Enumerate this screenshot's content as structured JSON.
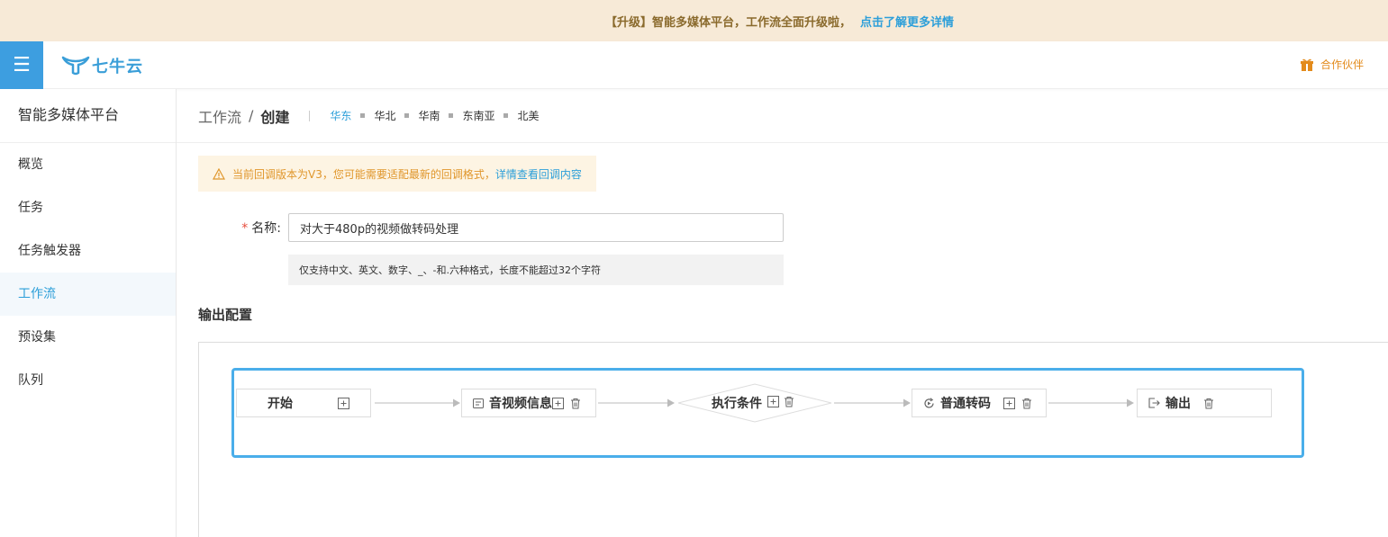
{
  "banner": {
    "text": "【升级】智能多媒体平台，工作流全面升级啦，",
    "link": "点击了解更多详情"
  },
  "header": {
    "logo_text": "七牛云",
    "partner": "合作伙伴"
  },
  "sidebar": {
    "title": "智能多媒体平台",
    "items": [
      {
        "label": "概览"
      },
      {
        "label": "任务"
      },
      {
        "label": "任务触发器"
      },
      {
        "label": "工作流"
      },
      {
        "label": "预设集"
      },
      {
        "label": "队列"
      }
    ],
    "active_index": 3
  },
  "breadcrumb": {
    "parent": "工作流",
    "sep": "/",
    "current": "创建"
  },
  "regions": [
    "华东",
    "华北",
    "华南",
    "东南亚",
    "北美"
  ],
  "warning": {
    "text": "当前回调版本为V3，您可能需要适配最新的回调格式，",
    "link": "详情查看回调内容"
  },
  "form": {
    "required": "*",
    "name_label": "名称:",
    "name_value": "对大于480p的视频做转码处理",
    "hint": "仅支持中文、英文、数字、_、-和.六种格式，长度不能超过32个字符"
  },
  "section": {
    "output_title": "输出配置"
  },
  "flow": {
    "nodes": [
      {
        "label": "开始"
      },
      {
        "label": "音视频信息"
      },
      {
        "label": "执行条件"
      },
      {
        "label": "普通转码"
      },
      {
        "label": "输出"
      }
    ]
  },
  "colors": {
    "accent": "#2d9fd9",
    "banner_bg": "#f7ead7",
    "warn_text": "#e0962b",
    "flow_border": "#4aaeea"
  }
}
